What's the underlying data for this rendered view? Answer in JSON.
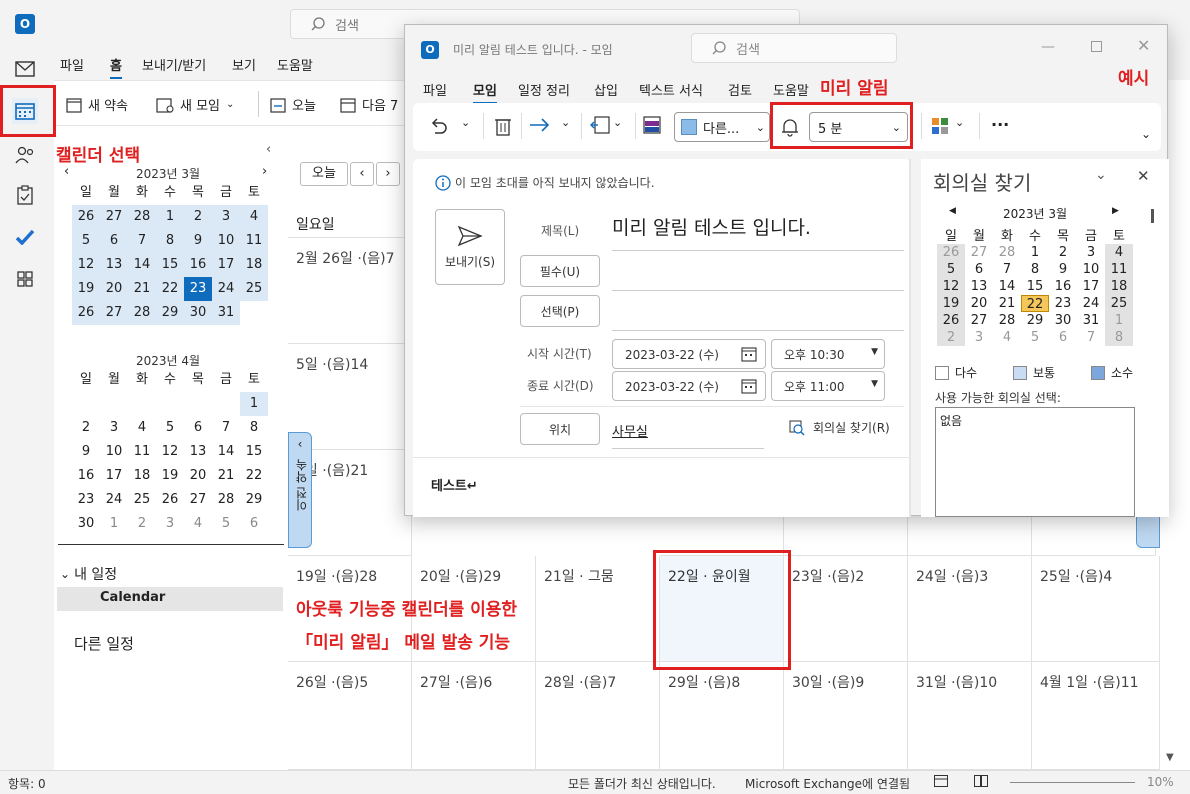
{
  "app": {
    "search_placeholder": "검색"
  },
  "ribbon": {
    "tabs": [
      "파일",
      "홈",
      "보내기/받기",
      "보기",
      "도움말"
    ],
    "new_appointment": "새 약속",
    "new_meeting": "새 모임",
    "today": "오늘",
    "next": "다음 7"
  },
  "left": {
    "march_title": "2023년 3월",
    "weekdays": [
      "일",
      "월",
      "화",
      "수",
      "목",
      "금",
      "토"
    ],
    "march_days": [
      "26",
      "27",
      "28",
      "1",
      "2",
      "3",
      "4",
      "5",
      "6",
      "7",
      "8",
      "9",
      "10",
      "11",
      "12",
      "13",
      "14",
      "15",
      "16",
      "17",
      "18",
      "19",
      "20",
      "21",
      "22",
      "23",
      "24",
      "25",
      "26",
      "27",
      "28",
      "29",
      "30",
      "31"
    ],
    "april_title": "2023년 4월",
    "april_days": [
      "",
      "",
      "",
      "",
      "",
      "",
      "1",
      "2",
      "3",
      "4",
      "5",
      "6",
      "7",
      "8",
      "9",
      "10",
      "11",
      "12",
      "13",
      "14",
      "15",
      "16",
      "17",
      "18",
      "19",
      "20",
      "21",
      "22",
      "23",
      "24",
      "25",
      "26",
      "27",
      "28",
      "29",
      "30",
      "1",
      "2",
      "3",
      "4",
      "5",
      "6"
    ],
    "my_calendars": "내 일정",
    "calendar_item": "Calendar",
    "other_calendars": "다른 일정"
  },
  "calendar": {
    "today_btn": "오늘",
    "header_day": "일요일",
    "rows": [
      [
        "2월 26일 ·(음)7"
      ],
      [
        "5일 ·(음)14"
      ],
      [
        "2일 ·(음)21"
      ],
      [
        "19일 ·(음)28",
        "20일 ·(음)29",
        "21일 · 그뭄",
        "22일 · 윤이월",
        "23일 ·(음)2",
        "24일 ·(음)3",
        "25일 ·(음)4"
      ],
      [
        "26일 ·(음)5",
        "27일 ·(음)6",
        "28일 ·(음)7",
        "29일 ·(음)8",
        "30일 ·(음)9",
        "31일 ·(음)10",
        "4월 1일 ·(음)11"
      ]
    ],
    "prev_appt": "이전 약속"
  },
  "status": {
    "items": "항목: 0",
    "sync": "모든 폴더가 최신 상태입니다.",
    "connected": "Microsoft Exchange에 연결됨",
    "zoom": "10%"
  },
  "dialog": {
    "title": "미리 알림 테스트 입니다.  -  모임",
    "search": "검색",
    "tabs": [
      "파일",
      "모임",
      "일정 정리",
      "삽입",
      "텍스트 서식",
      "검토",
      "도움말"
    ],
    "color_label": "다른...",
    "reminder": "5 분",
    "info": "이 모임 초대를 아직 보내지 않았습니다.",
    "send": "보내기(S)",
    "subject_label": "제목(L)",
    "subject": "미리 알림 테스트 입니다.",
    "required": "필수(U)",
    "optional": "선택(P)",
    "start_label": "시작 시간(T)",
    "start_date": "2023-03-22 (수)",
    "start_time": "오후 10:30",
    "end_label": "종료 시간(D)",
    "end_date": "2023-03-22 (수)",
    "end_time": "오후 11:00",
    "location_btn": "위치",
    "location": "사무실",
    "room_finder_link": "회의실 찾기(R)",
    "body": "테스트↵",
    "room_finder": {
      "title": "회의실 찾기",
      "month": "2023년 3월",
      "days": [
        "26",
        "27",
        "28",
        "1",
        "2",
        "3",
        "4",
        "5",
        "6",
        "7",
        "8",
        "9",
        "10",
        "11",
        "12",
        "13",
        "14",
        "15",
        "16",
        "17",
        "18",
        "19",
        "20",
        "21",
        "22",
        "23",
        "24",
        "25",
        "26",
        "27",
        "28",
        "29",
        "30",
        "31",
        "1",
        "2",
        "3",
        "4",
        "5",
        "6",
        "7",
        "8"
      ],
      "legend": [
        "다수",
        "보통",
        "소수"
      ],
      "select_label": "사용 가능한 회의실 선택:",
      "list_value": "없음"
    }
  },
  "annotations": {
    "calendar_select": "캘린더 선택",
    "reminder": "미리 알림",
    "example": "예시",
    "desc1": "아웃룩 기능중 캘린더를 이용한",
    "desc2": "「미리 알림」 메일 발송 기능"
  },
  "colors": {
    "accent": "#0f6cbd",
    "highlight": "#e02020",
    "selected_range": "#dbe9f7",
    "today_room": "#f5c65a"
  }
}
